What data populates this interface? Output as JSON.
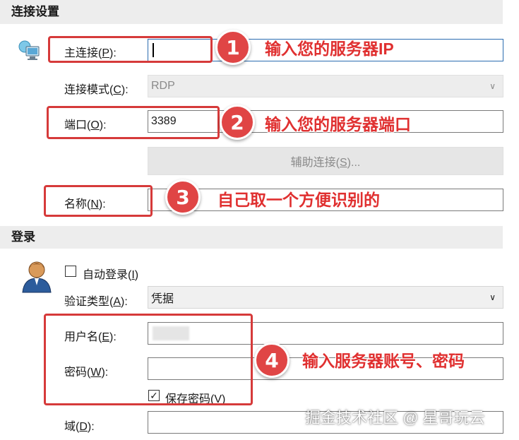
{
  "connection": {
    "header": "连接设置",
    "primary_label": "主连接(P):",
    "primary_value": "",
    "mode_label": "连接模式(C):",
    "mode_value": "RDP",
    "port_label": "端口(O):",
    "port_value": "3389",
    "aux_button": "辅助连接(S)...",
    "name_label": "名称(N):",
    "name_value": ""
  },
  "login": {
    "header": "登录",
    "autologin_label": "自动登录(I)",
    "auth_type_label": "验证类型(A):",
    "auth_type_value": "凭据",
    "username_label": "用户名(E):",
    "password_label": "密码(W):",
    "save_password_label": "保存密码(V)",
    "domain_label": "域(D):"
  },
  "annotations": {
    "n1": "1",
    "n2": "2",
    "n3": "3",
    "n4": "4",
    "note1": "输入您的服务器IP",
    "note2": "输入您的服务器端口",
    "note3": "自己取一个方便识别的",
    "note4": "输入服务器账号、密码"
  },
  "watermark": "掘金技术社区 @ 星哥玩云",
  "icons": {
    "connection": "network-computer-icon",
    "user": "user-avatar-icon",
    "check": "checkmark-icon",
    "dropdown": "chevron-down-icon"
  },
  "colors": {
    "annotation_red": "#e04545",
    "field_border": "#7a7a7a",
    "active_border": "#2b6cb0",
    "header_bg": "#ededed"
  }
}
